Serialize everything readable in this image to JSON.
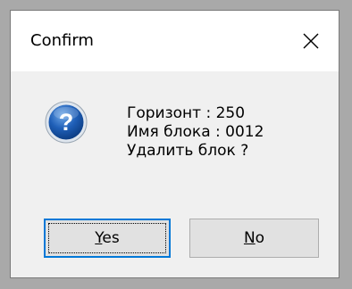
{
  "dialog": {
    "title": "Confirm",
    "close_icon": "close-icon",
    "message_icon": "question-icon",
    "lines": [
      "Горизонт : 250",
      "Имя блока : 0012",
      "Удалить блок ?"
    ],
    "buttons": {
      "yes": {
        "mnemonic": "Y",
        "rest": "es"
      },
      "no": {
        "mnemonic": "N",
        "rest": "o"
      }
    }
  },
  "colors": {
    "focus_border": "#0078d7",
    "button_face": "#e1e1e1",
    "dialog_bg": "#f0f0f0"
  }
}
